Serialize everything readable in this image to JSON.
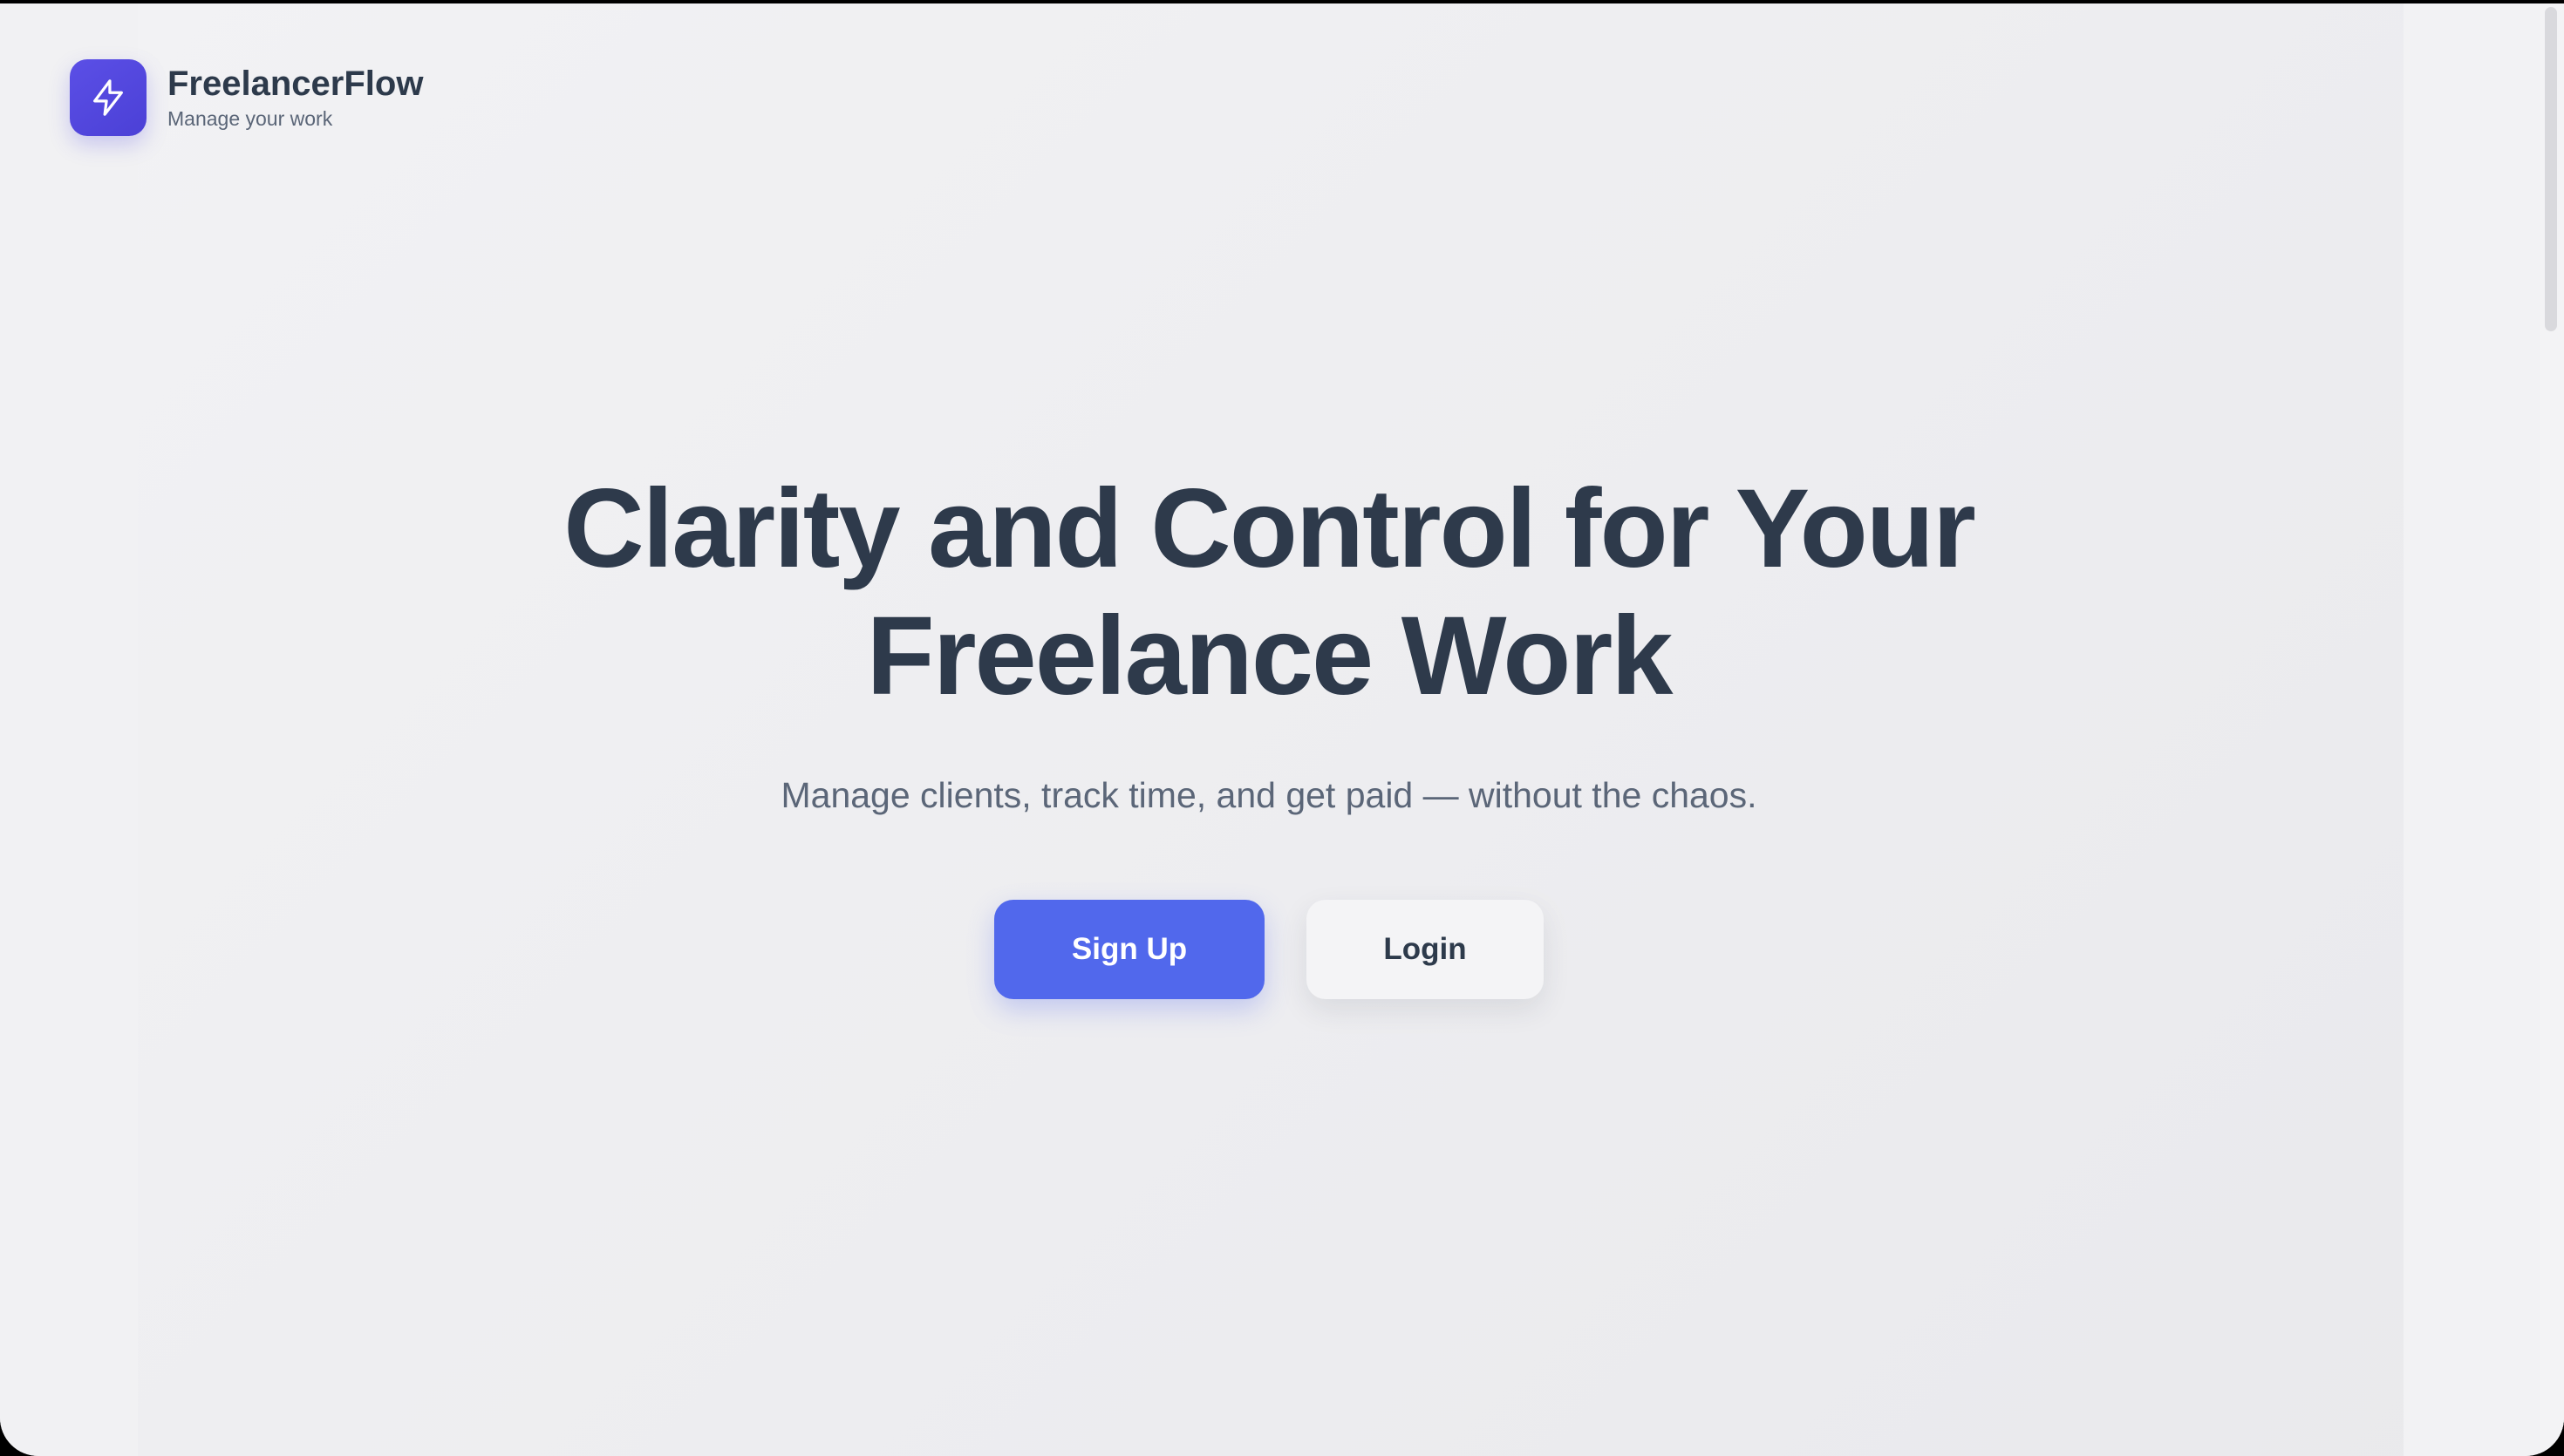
{
  "brand": {
    "name": "FreelancerFlow",
    "tagline": "Manage your work",
    "logo_icon": "lightning-bolt-icon",
    "accent_color": "#5046e5"
  },
  "hero": {
    "headline_line1": "Clarity and Control for Your",
    "headline_line2": "Freelance Work",
    "subtitle": "Manage clients, track time, and get paid — without the chaos."
  },
  "actions": {
    "signup_label": "Sign Up",
    "login_label": "Login",
    "primary_color": "#5168ec"
  }
}
